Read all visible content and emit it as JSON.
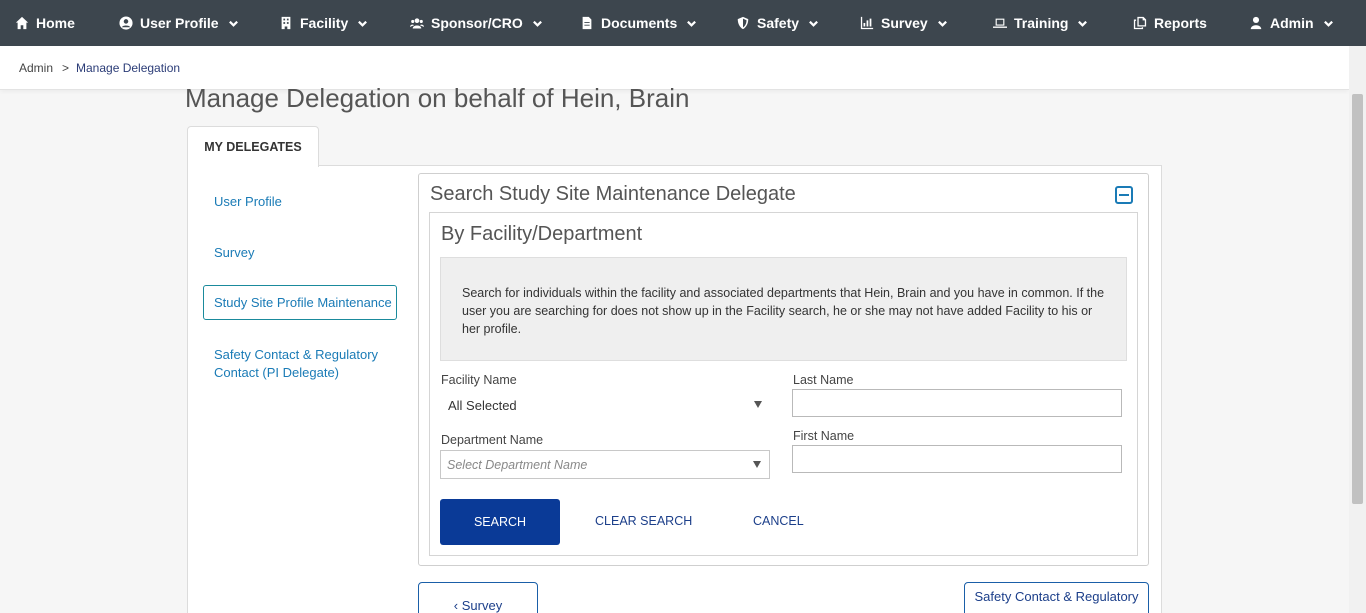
{
  "nav": {
    "home": "Home",
    "user_profile": "User Profile",
    "facility": "Facility",
    "sponsor": "Sponsor/CRO",
    "documents": "Documents",
    "safety": "Safety",
    "survey": "Survey",
    "training": "Training",
    "reports": "Reports",
    "admin": "Admin"
  },
  "breadcrumb": {
    "parent": "Admin",
    "separator": ">",
    "current": "Manage Delegation"
  },
  "page_title": "Manage Delegation on behalf of Hein, Brain",
  "tab_label": "MY DELEGATES",
  "sidebar": {
    "items": [
      "User Profile",
      "Survey",
      "Study Site Profile Maintenance",
      "Safety Contact & Regulatory Contact (PI Delegate)"
    ]
  },
  "panel": {
    "title": "Search Study Site Maintenance Delegate",
    "subtitle": "By Facility/Department",
    "info": "Search for individuals within the facility and associated departments that Hein, Brain and you have in common. If the user you are searching for does not show up in the Facility search, he or she may not have added Facility to his or her profile."
  },
  "form": {
    "facility_label": "Facility Name",
    "facility_value": "All Selected",
    "department_label": "Department Name",
    "department_placeholder": "Select Department Name",
    "last_name_label": "Last Name",
    "last_name_value": "",
    "first_name_label": "First Name",
    "first_name_value": ""
  },
  "actions": {
    "search": "SEARCH",
    "clear": "CLEAR SEARCH",
    "cancel": "CANCEL"
  },
  "pager": {
    "prev": "‹ Survey",
    "next": "Safety Contact & Regulatory"
  },
  "colors": {
    "nav_bg": "#3d464e",
    "primary_button": "#0a3a97",
    "link": "#1a7bb6"
  }
}
